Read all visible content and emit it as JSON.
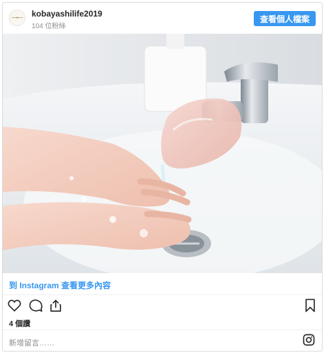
{
  "header": {
    "username": "kobayashilife2019",
    "followers": "104 位粉絲",
    "profile_button": "查看個人檔案"
  },
  "more_link": "到 Instagram 查看更多內容",
  "likes": "4 個讚",
  "comment_placeholder": "新增留言……",
  "icons": {
    "like": "heart-icon",
    "comment": "comment-icon",
    "share": "share-icon",
    "save": "bookmark-icon",
    "instagram": "instagram-icon"
  },
  "colors": {
    "accent": "#3897f0",
    "text": "#262626",
    "muted": "#8e8e8e"
  }
}
